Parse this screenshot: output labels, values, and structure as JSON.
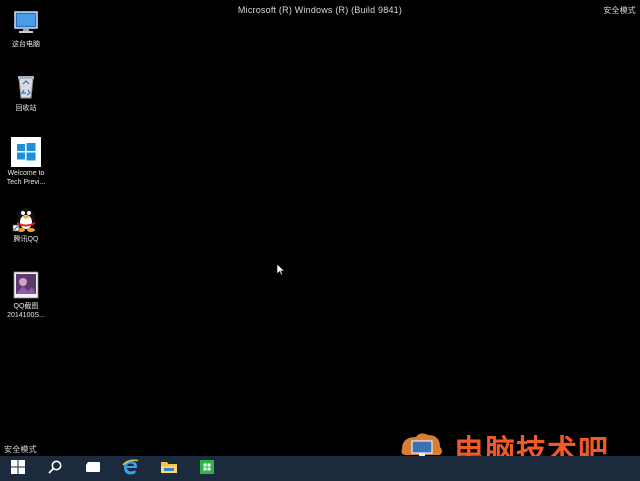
{
  "screen": {
    "build_text": "Microsoft (R) Windows (R) (Build 9841)",
    "safe_mode_top_right": "安全模式",
    "safe_mode_bottom_left": "安全模式",
    "background_color": "#000000"
  },
  "desktop_icons": [
    {
      "icon": "computer-icon",
      "label": "这台电脑"
    },
    {
      "icon": "recycle-bin-icon",
      "label": "回收站"
    },
    {
      "icon": "windows-welcome-icon",
      "label_line1": "Welcome to",
      "label_line2": "Tech Previ..."
    },
    {
      "icon": "qq-penguin-icon",
      "label": "腾讯QQ"
    },
    {
      "icon": "screenshot-image-icon",
      "label_line1": "QQ截图",
      "label_line2": "2014100S..."
    }
  ],
  "taskbar": {
    "background": "#1c2a3d",
    "items": [
      "start-icon",
      "search-icon",
      "task-view-icon",
      "edge-ie-icon",
      "file-explorer-icon",
      "store-icon"
    ]
  },
  "watermark": {
    "text": "电脑技术吧",
    "color": "#f05a28"
  }
}
